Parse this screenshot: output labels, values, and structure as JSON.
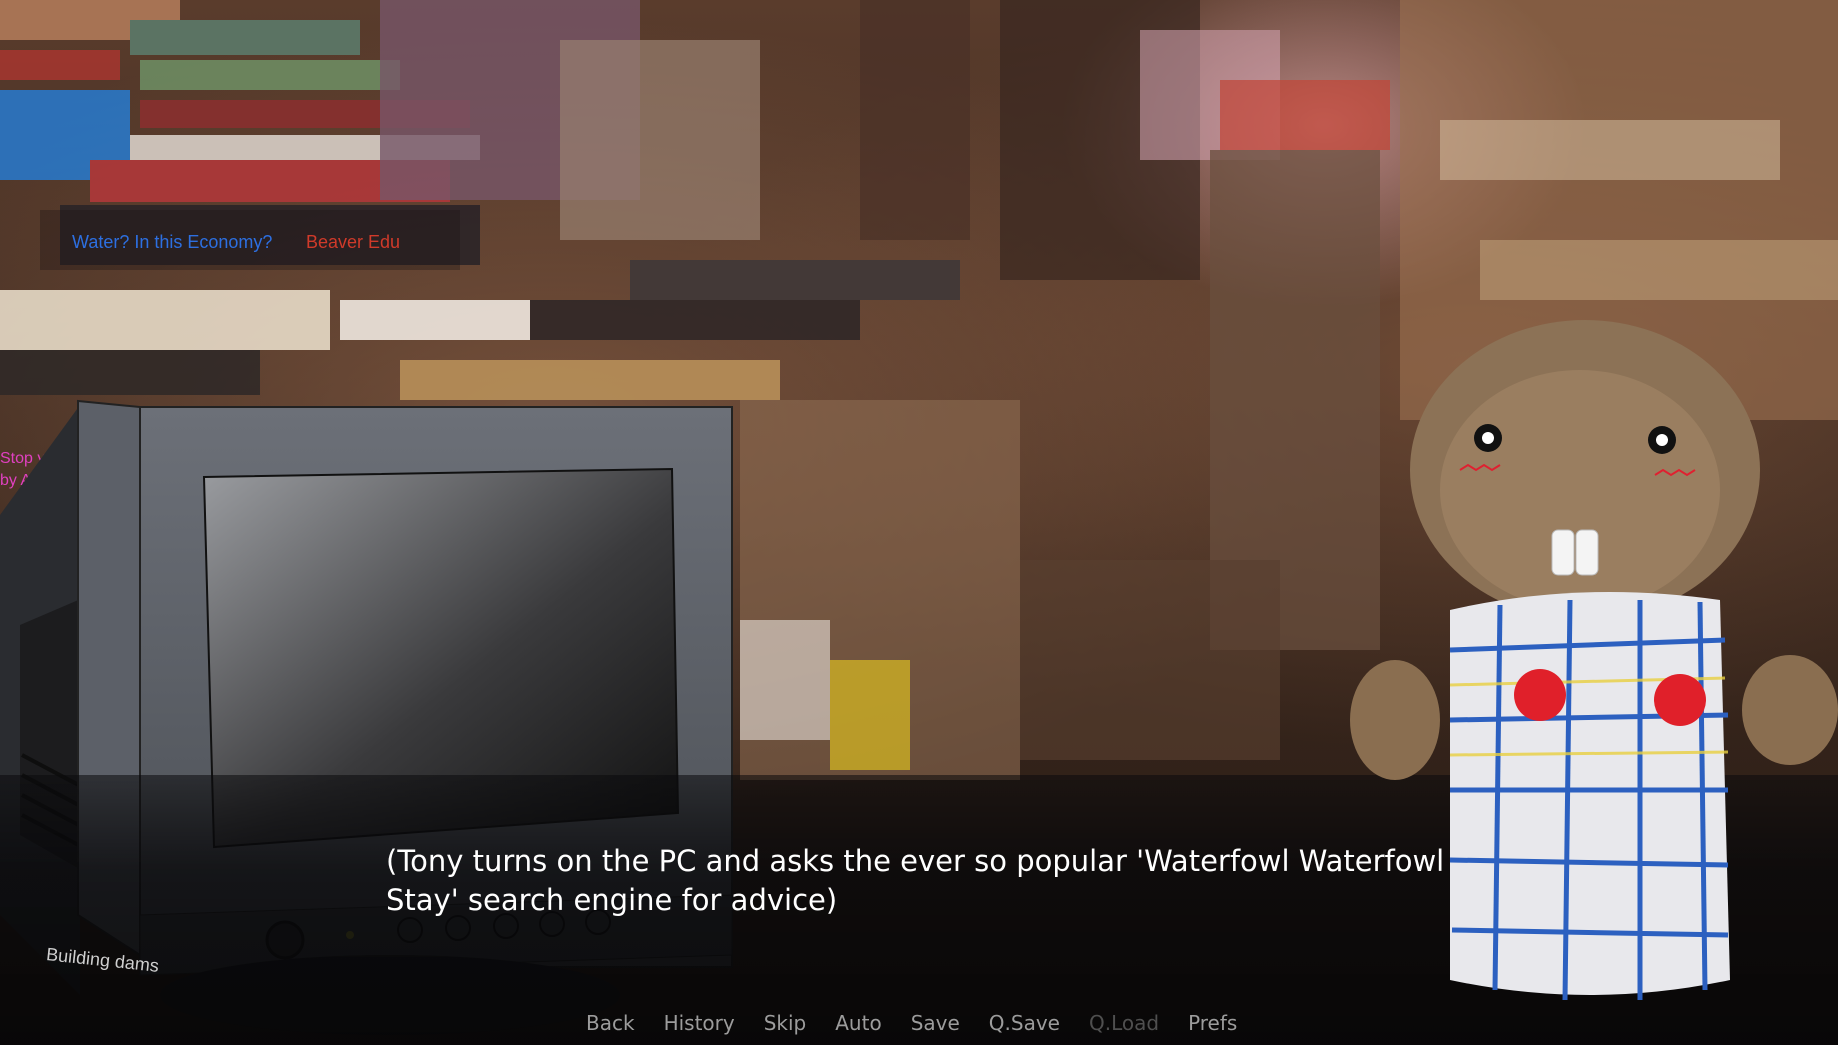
{
  "scene": {
    "poster": {
      "title": "Water? In this Economy?",
      "brand": "Beaver Edu"
    },
    "pink_note": [
      "Stop your",
      "by A"
    ],
    "dams_note": "Building dams"
  },
  "dialogue": {
    "text": "(Tony turns on the PC and asks the ever so popular 'Waterfowl Waterfowl Stay' search engine for advice)"
  },
  "quick_menu": {
    "back": "Back",
    "history": "History",
    "skip": "Skip",
    "auto": "Auto",
    "save": "Save",
    "qsave": "Q.Save",
    "qload": "Q.Load",
    "prefs": "Prefs"
  },
  "colors": {
    "dialogue_text": "#ffffff",
    "menu_text": "#9c9c9c",
    "menu_disabled": "#4f4f4f",
    "poster_title": "#2d6fe0",
    "poster_brand": "#d03a2a"
  }
}
